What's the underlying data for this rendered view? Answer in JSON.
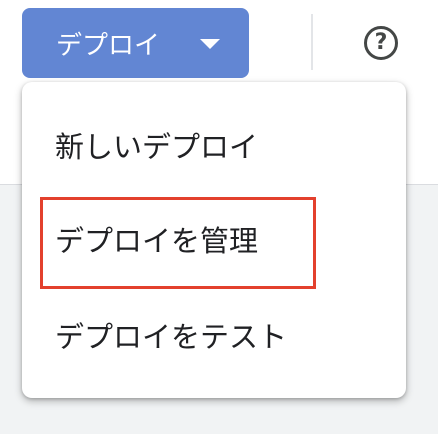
{
  "toolbar": {
    "deploy_label": "デプロイ",
    "deploy_caret_icon": "caret-down-icon",
    "help_icon": "help-circle-icon",
    "help_glyph": "?"
  },
  "deploy_menu": {
    "items": [
      {
        "label": "新しいデプロイ"
      },
      {
        "label": "デプロイを管理",
        "highlighted": true
      },
      {
        "label": "デプロイをテスト"
      }
    ]
  },
  "colors": {
    "primary_button": "#6286d3",
    "highlight_border": "#e3402d",
    "menu_text": "#202124",
    "icon": "#444746"
  }
}
